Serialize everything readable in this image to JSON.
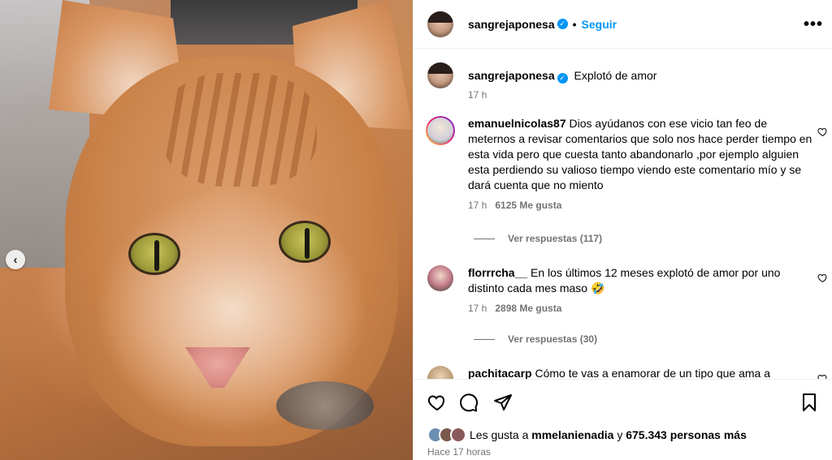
{
  "post": {
    "author": "sangrejaponesa",
    "follow_label": "Seguir",
    "separator": "•",
    "caption": "Explotó de amor",
    "caption_time": "17 h"
  },
  "comments": [
    {
      "user": "emanuelnicolas87",
      "text": "Dios ayúdanos con ese vicio tan feo de meternos a revisar comentarios que solo nos hace perder tiempo en esta vida pero que cuesta tanto abandonarlo ,por ejemplo alguien esta perdiendo su valioso tiempo viendo este comentario mío y se dará cuenta que no miento",
      "time": "17 h",
      "likes": "6125 Me gusta",
      "replies": "Ver respuestas (117)"
    },
    {
      "user": "florrrcha__",
      "text": "En los últimos 12 meses explotó de amor por uno distinto cada mes maso",
      "emoji": "🤣",
      "time": "17 h",
      "likes": "2898 Me gusta",
      "replies": "Ver respuestas (30)"
    },
    {
      "user": "pachitacarp",
      "text": "Cómo te vas a enamorar de un tipo que ama a"
    }
  ],
  "likes_bar": {
    "prefix": "Les gusta a",
    "user": "mmelanienadia",
    "conj": "y",
    "others": "675.343 personas más",
    "time": "Hace 17 horas"
  },
  "icons": {
    "more": "more-options-icon",
    "verified": "verified-badge-icon",
    "heart": "heart-icon",
    "comment": "comment-icon",
    "share": "share-icon",
    "save": "bookmark-icon",
    "prev": "chevron-left-icon"
  },
  "colors": {
    "accent": "#0095f6",
    "muted": "#737373",
    "border": "#efefef"
  }
}
